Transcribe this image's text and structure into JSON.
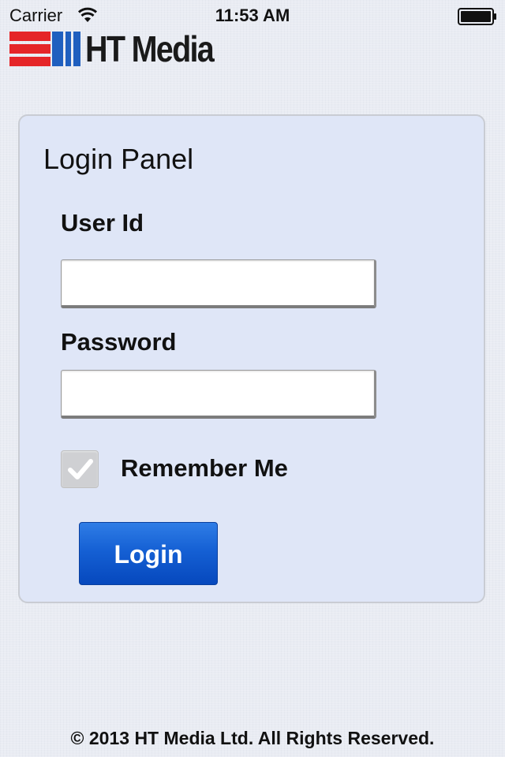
{
  "status_bar": {
    "carrier": "Carrier",
    "time": "11:53 AM"
  },
  "logo": {
    "text": "HT Media",
    "colors": {
      "red": "#e52528",
      "blue": "#1f5fbf"
    }
  },
  "login_panel": {
    "title": "Login Panel",
    "user_id": {
      "label": "User Id",
      "value": "",
      "placeholder": ""
    },
    "password": {
      "label": "Password",
      "value": "",
      "placeholder": ""
    },
    "remember_me": {
      "label": "Remember Me",
      "checked": true,
      "disabled": true
    },
    "login_button": {
      "label": "Login"
    },
    "colors": {
      "panel_bg": "#dfe6f7",
      "button": "#1560d4"
    }
  },
  "footer": {
    "copyright": "© 2013 HT Media Ltd. All Rights Reserved."
  }
}
